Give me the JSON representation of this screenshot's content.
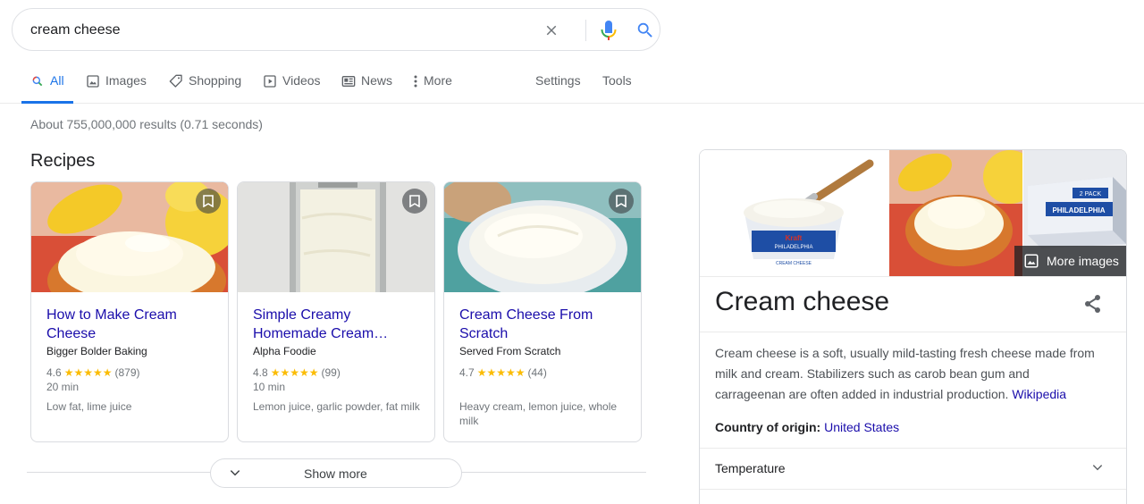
{
  "search": {
    "query": "cream cheese",
    "clear_icon": "close-icon",
    "mic_icon": "microphone-icon",
    "search_icon": "search-icon"
  },
  "tabs": [
    {
      "label": "All",
      "icon": "search-icon",
      "active": true
    },
    {
      "label": "Images",
      "icon": "image-icon"
    },
    {
      "label": "Shopping",
      "icon": "tag-icon"
    },
    {
      "label": "Videos",
      "icon": "play-icon"
    },
    {
      "label": "News",
      "icon": "newspaper-icon"
    },
    {
      "label": "More",
      "icon": "more-vert-icon"
    }
  ],
  "tools": {
    "settings": "Settings",
    "tools": "Tools"
  },
  "result_stats": "About 755,000,000 results (0.71 seconds)",
  "recipes": {
    "title": "Recipes",
    "cards": [
      {
        "title": "How to Make Cream Cheese",
        "source": "Bigger Bolder Baking",
        "rating": "4.6",
        "stars": "★★★★★",
        "reviews": "(879)",
        "time": "20 min",
        "ingredients": "Low fat, lime juice"
      },
      {
        "title": "Simple Creamy Homemade Cream…",
        "source": "Alpha Foodie",
        "rating": "4.8",
        "stars": "★★★★★",
        "reviews": "(99)",
        "time": "10 min",
        "ingredients": "Lemon juice, garlic powder, fat milk"
      },
      {
        "title": "Cream Cheese From Scratch",
        "source": "Served From Scratch",
        "rating": "4.7",
        "stars": "★★★★★",
        "reviews": "(44)",
        "time": "",
        "ingredients": "Heavy cream, lemon juice, whole milk"
      }
    ],
    "show_more": "Show more"
  },
  "knowledge_panel": {
    "title": "Cream cheese",
    "more_images": "More images",
    "description": "Cream cheese is a soft, usually mild-tasting fresh cheese made from milk and cream. Stabilizers such as carob bean gum and carrageenan are often added in industrial production.",
    "source_link": "Wikipedia",
    "fact_label": "Country of origin:",
    "fact_value": "United States",
    "accordion": "Temperature",
    "product_pack_label": "2 PACK",
    "product_brand": "PHILADELPHIA",
    "tub_label": "CREAM CHEESE"
  },
  "colors": {
    "link": "#1a0dab",
    "accent": "#1a73e8",
    "star": "#fbbc04"
  }
}
